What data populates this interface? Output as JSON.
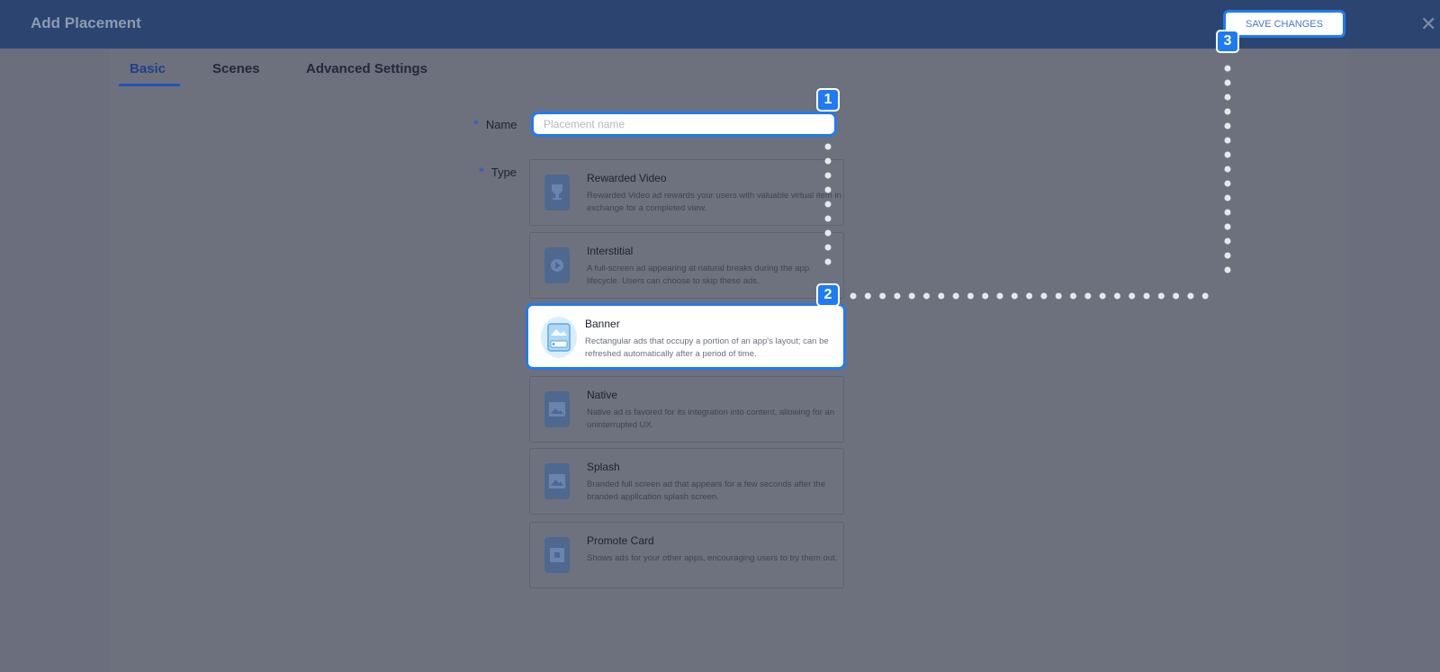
{
  "header": {
    "title": "Add Placement",
    "save_label": "SAVE CHANGES",
    "close_icon": "close-icon"
  },
  "tabs": [
    {
      "label": "Basic",
      "active": true
    },
    {
      "label": "Scenes",
      "active": false
    },
    {
      "label": "Advanced Settings",
      "active": false
    }
  ],
  "form": {
    "required_mark": "*",
    "name_label": "Name",
    "name_placeholder": "Placement name",
    "name_value": "",
    "type_label": "Type"
  },
  "types": [
    {
      "title": "Rewarded Video",
      "desc": "Rewarded Video ad rewards your users with valuable virtual item in exchange for a completed view.",
      "icon": "trophy-icon",
      "selected": false
    },
    {
      "title": "Interstitial",
      "desc": "A full-screen ad appearing at natural breaks during the app lifecycle. Users can choose to skip these ads.",
      "icon": "play-icon",
      "selected": false
    },
    {
      "title": "Banner",
      "desc": "Rectangular ads that occupy a portion of an app's layout; can be refreshed automatically after a period of time.",
      "icon": "banner-icon",
      "selected": true
    },
    {
      "title": "Native",
      "desc": "Native ad is favored for its integration into content, allowing for an uninterrupted UX.",
      "icon": "image-icon",
      "selected": false
    },
    {
      "title": "Splash",
      "desc": "Branded full screen ad that appears for a few seconds after the branded application splash screen.",
      "icon": "splash-icon",
      "selected": false
    },
    {
      "title": "Promote Card",
      "desc": "Shows ads for your other apps, encouraging users to try them out.",
      "icon": "card-icon",
      "selected": false
    }
  ],
  "badges": [
    "1",
    "2",
    "3"
  ],
  "colors": {
    "header": "#2c4470",
    "accent": "#1e7bf3",
    "overlay": "#6b6f7d"
  }
}
